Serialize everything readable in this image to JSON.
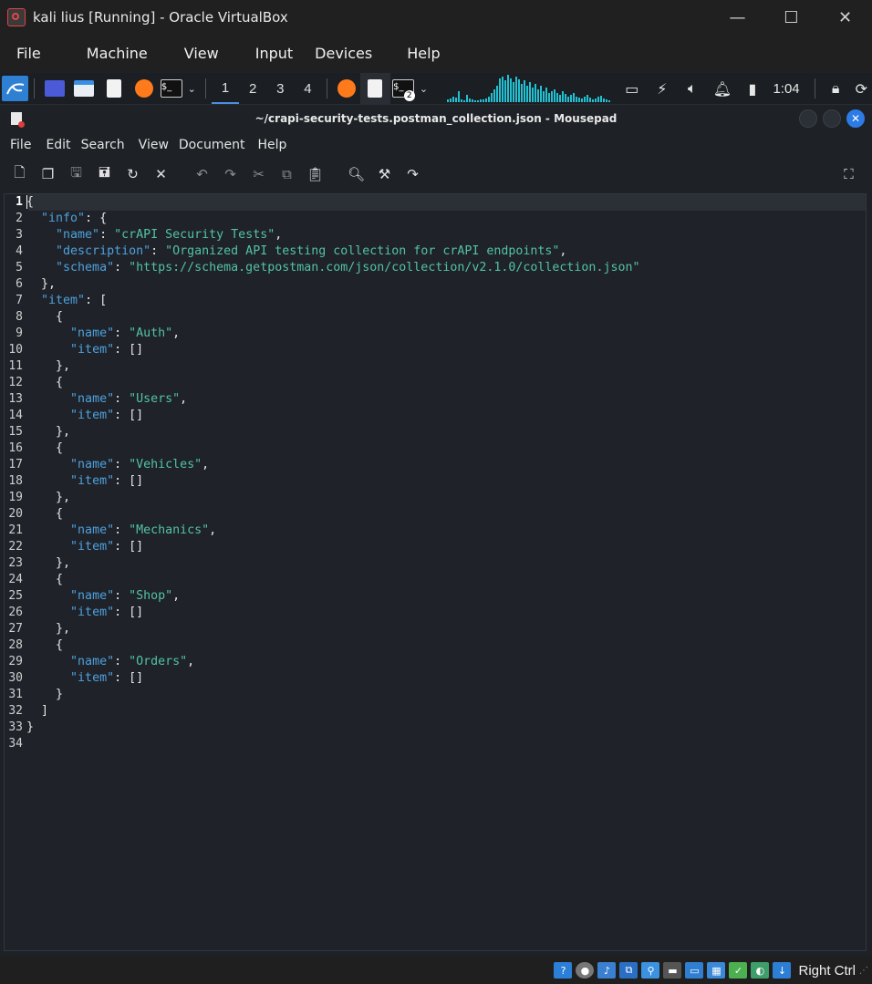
{
  "vbox": {
    "title": "kali lius [Running] - Oracle VirtualBox",
    "menu": [
      "File",
      "Machine",
      "View",
      "Input",
      "Devices",
      "Help"
    ],
    "controls": {
      "minimize": "—",
      "maximize": "☐",
      "close": "✕"
    },
    "status": {
      "host_key": "Right Ctrl"
    }
  },
  "panel": {
    "workspaces": [
      "1",
      "2",
      "3",
      "4"
    ],
    "terminal_badge": "2",
    "clock": "1:04",
    "accent": "#2f7fd3",
    "viz_color": "#21c1d4"
  },
  "mousepad": {
    "title": "~/crapi-security-tests.postman_collection.json - Mousepad",
    "menu": [
      "File",
      "Edit",
      "Search",
      "View",
      "Document",
      "Help"
    ],
    "toolbar_icons": [
      "new-document-icon",
      "new-window-icon",
      "save-icon",
      "save-as-icon",
      "reload-icon",
      "close-doc-icon",
      "undo-icon",
      "redo-icon",
      "cut-icon",
      "copy-icon",
      "paste-icon",
      "find-icon",
      "find-replace-icon",
      "go-to-line-icon",
      "fullscreen-icon"
    ],
    "current_line": 1,
    "line_numbers": [
      "1",
      "2",
      "3",
      "4",
      "5",
      "6",
      "7",
      "8",
      "9",
      "10",
      "11",
      "12",
      "13",
      "14",
      "15",
      "16",
      "17",
      "18",
      "19",
      "20",
      "21",
      "22",
      "23",
      "24",
      "25",
      "26",
      "27",
      "28",
      "29",
      "30",
      "31",
      "32",
      "33",
      "34"
    ],
    "lines": [
      "{",
      "  \"info\": {",
      "    \"name\": \"crAPI Security Tests\",",
      "    \"description\": \"Organized API testing collection for crAPI endpoints\",",
      "    \"schema\": \"https://schema.getpostman.com/json/collection/v2.1.0/collection.json\"",
      "  },",
      "  \"item\": [",
      "    {",
      "      \"name\": \"Auth\",",
      "      \"item\": []",
      "    },",
      "    {",
      "      \"name\": \"Users\",",
      "      \"item\": []",
      "    },",
      "    {",
      "      \"name\": \"Vehicles\",",
      "      \"item\": []",
      "    },",
      "    {",
      "      \"name\": \"Mechanics\",",
      "      \"item\": []",
      "    },",
      "    {",
      "      \"name\": \"Shop\",",
      "      \"item\": []",
      "    },",
      "    {",
      "      \"name\": \"Orders\",",
      "      \"item\": []",
      "    }",
      "  ]",
      "}",
      ""
    ],
    "colors": {
      "key": "#4ea1de",
      "string": "#52c3a4",
      "text": "#e6e6e6"
    }
  }
}
